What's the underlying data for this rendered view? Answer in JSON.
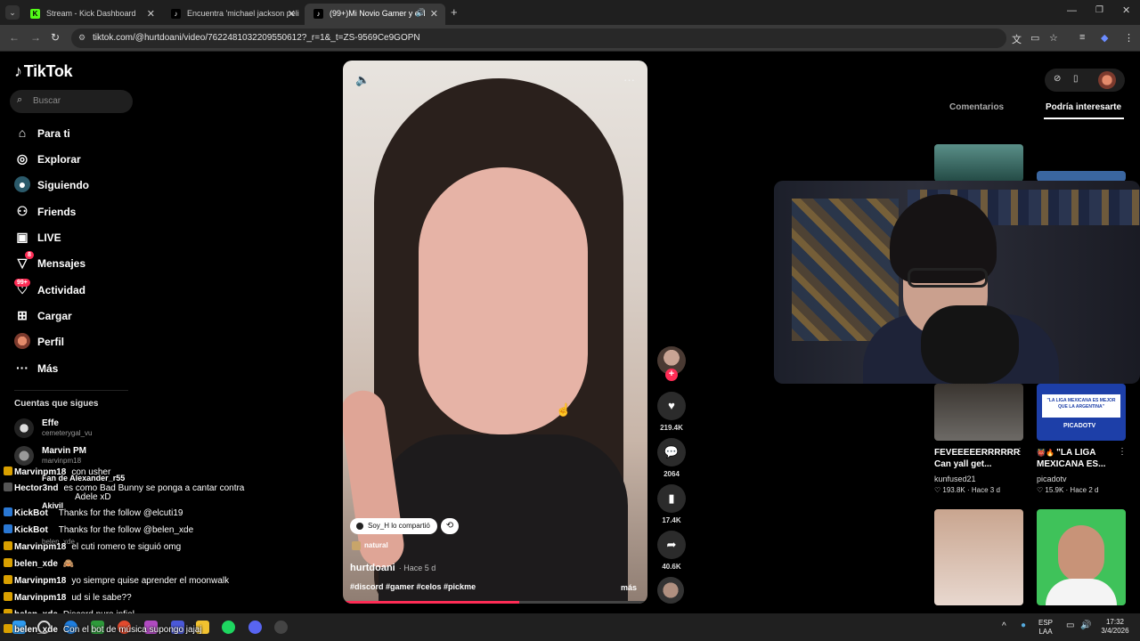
{
  "browser": {
    "tabs": [
      {
        "title": "Stream - Kick Dashboard",
        "icon": "kick-icon",
        "color": "#53fc18"
      },
      {
        "title": "Encuentra 'michael jackson peli",
        "icon": "tiktok-icon",
        "color": "#ffffff"
      },
      {
        "title": "(99+)Mi Novio Gamer y el I",
        "icon": "tiktok-icon",
        "color": "#ffffff"
      }
    ],
    "url": "tiktok.com/@hurtdoani/video/7622481032209550612?_r=1&_t=ZS-9569Ce9GOPN"
  },
  "tiktok": {
    "logo": "TikTok",
    "search_placeholder": "Buscar",
    "nav": [
      {
        "label": "Para ti",
        "icon": "home-icon"
      },
      {
        "label": "Explorar",
        "icon": "compass-icon"
      },
      {
        "label": "Siguiendo",
        "icon": "following-icon"
      },
      {
        "label": "Friends",
        "icon": "friends-icon"
      },
      {
        "label": "LIVE",
        "icon": "live-icon"
      },
      {
        "label": "Mensajes",
        "icon": "messages-icon",
        "badge": "8"
      },
      {
        "label": "Actividad",
        "icon": "activity-icon",
        "badge": "99+"
      },
      {
        "label": "Cargar",
        "icon": "upload-icon"
      },
      {
        "label": "Perfil",
        "icon": "profile-icon"
      },
      {
        "label": "Más",
        "icon": "more-icon"
      }
    ],
    "following_heading": "Cuentas que sigues",
    "accounts": [
      {
        "name": "Effe",
        "handle": "cemeterygal_vu"
      },
      {
        "name": "Marvin PM",
        "handle": "marvinpm18"
      },
      {
        "name": "Fan de Alexander_r55",
        "handle": ""
      },
      {
        "name": "Akivil",
        "handle": ""
      },
      {
        "name": "KickBot",
        "handle": "belen_xde"
      }
    ]
  },
  "video": {
    "shared_by": "Soy_H lo compartió",
    "tag": "natural",
    "author": "hurtdoani",
    "time": "· Hace 5 d",
    "hashtags": "#discord #gamer #celos #pickme",
    "more": "más",
    "progress": 0.58,
    "likes": "219.4K",
    "comments": "2064",
    "saves": "17.4K",
    "shares": "40.6K"
  },
  "right_panel": {
    "tab_comments": "Comentarios",
    "tab_suggested": "Podría interesarte",
    "cards": [
      {
        "title": "FEVEEEEERRRRRR Can yall get...",
        "user": "kunfused21",
        "likes": "193.8K",
        "time": "Hace 3 d"
      },
      {
        "title": "\"LA LIGA MEXICANA ES...",
        "user": "picadotv",
        "likes": "15.9K",
        "time": "Hace 2 d",
        "thumb_text": "\"LA LIGA MEXICANA ES MEJOR QUE LA ARGENTINA\"",
        "thumb_brand": "PICADOTV"
      }
    ]
  },
  "chat": [
    {
      "user": "Marvinpm18",
      "text": "con usher"
    },
    {
      "user": "Hector3nd",
      "text": "es como Bad Bunny se ponga a cantar contra"
    },
    {
      "user": "",
      "text": "Adele xD"
    },
    {
      "user": "KickBot",
      "text": "Thanks for the follow @elcuti19"
    },
    {
      "user": "KickBot",
      "text": "Thanks for the follow @belen_xde"
    },
    {
      "user": "Marvinpm18",
      "text": "el cuti romero te siguió omg"
    },
    {
      "user": "belen_xde",
      "text": ""
    },
    {
      "user": "Marvinpm18",
      "text": "yo siempre quise aprender el moonwalk"
    },
    {
      "user": "Marvinpm18",
      "text": "ud si le sabe??"
    },
    {
      "user": "belen_xde",
      "text": "Discord puro infiel"
    },
    {
      "user": "belen_xde",
      "text": "Con el bot de música supongo jajaj"
    }
  ],
  "taskbar": {
    "lang": "ESP",
    "layout": "LAA",
    "time": "17:32",
    "date": "3/4/2026"
  }
}
